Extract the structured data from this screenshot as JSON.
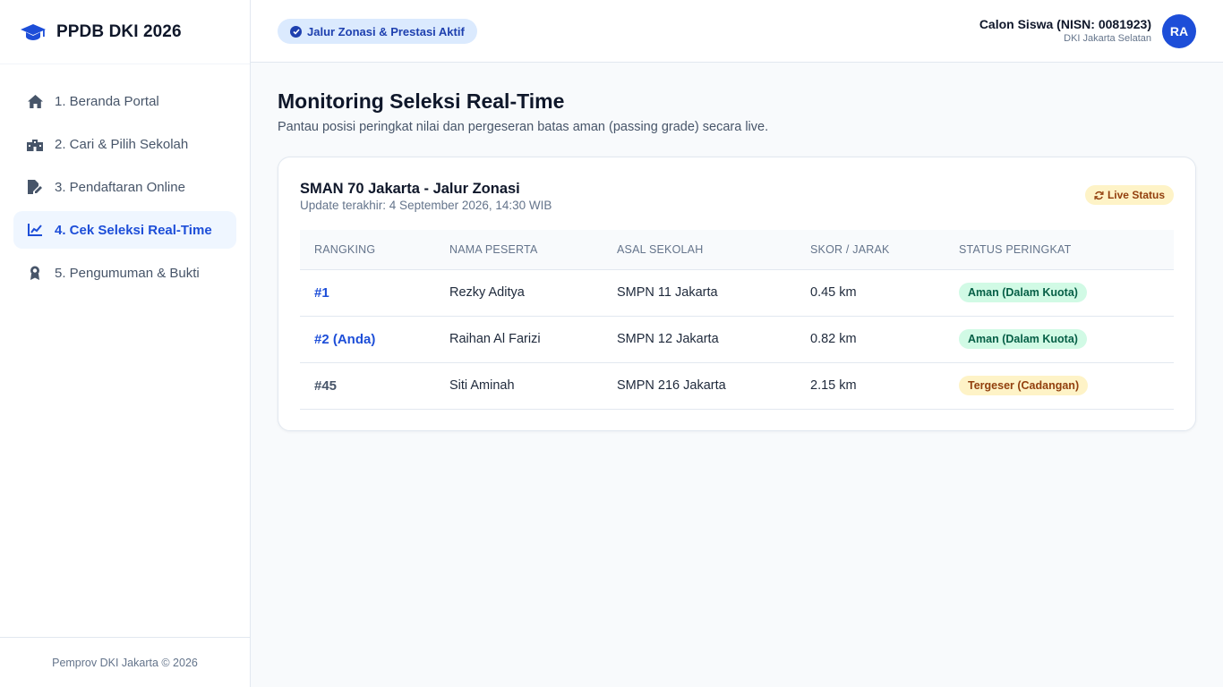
{
  "app": {
    "brand": "PPDB DKI 2026",
    "brand_icon": "graduation-cap-icon"
  },
  "sidebar": {
    "items": [
      {
        "label": "1. Beranda Portal",
        "icon": "home-icon",
        "active": false
      },
      {
        "label": "2. Cari & Pilih Sekolah",
        "icon": "school-icon",
        "active": false
      },
      {
        "label": "3. Pendaftaran Online",
        "icon": "file-edit-icon",
        "active": false
      },
      {
        "label": "4. Cek Seleksi Real-Time",
        "icon": "chart-line-icon",
        "active": true
      },
      {
        "label": "5. Pengumuman & Bukti",
        "icon": "award-icon",
        "active": false
      }
    ],
    "footer": "Pemprov DKI Jakarta © 2026"
  },
  "header": {
    "pill": "Jalur Zonasi & Prestasi Aktif",
    "user_name": "Calon Siswa (NISN: 0081923)",
    "user_location": "DKI Jakarta Selatan",
    "avatar_initials": "RA"
  },
  "main": {
    "title": "Monitoring Seleksi Real-Time",
    "subtitle": "Pantau posisi peringkat nilai dan pergeseran batas aman (passing grade) secara live."
  },
  "card": {
    "title": "SMAN 70 Jakarta - Jalur Zonasi",
    "updated": "Update terakhir: 4 September 2026, 14:30 WIB",
    "live_label": "Live Status",
    "columns": [
      "RANGKING",
      "NAMA PESERTA",
      "ASAL SEKOLAH",
      "SKOR / JARAK",
      "STATUS PERINGKAT"
    ],
    "rows": [
      {
        "rank": "#1",
        "name": "Rezky Aditya",
        "school": "SMPN 11 Jakarta",
        "score": "0.45 km",
        "status": "Aman (Dalam Kuota)"
      },
      {
        "rank": "#2 (Anda)",
        "name": "Raihan Al Farizi",
        "school": "SMPN 12 Jakarta",
        "score": "0.82 km",
        "status": "Aman (Dalam Kuota)"
      },
      {
        "rank": "#45",
        "name": "Siti Aminah",
        "school": "SMPN 216 Jakarta",
        "score": "2.15 km",
        "status": "Tergeser (Cadangan)"
      }
    ]
  },
  "colors": {
    "accent": "#1d4ed8",
    "safe": "#d1fae5",
    "warn": "#fef3c7"
  }
}
